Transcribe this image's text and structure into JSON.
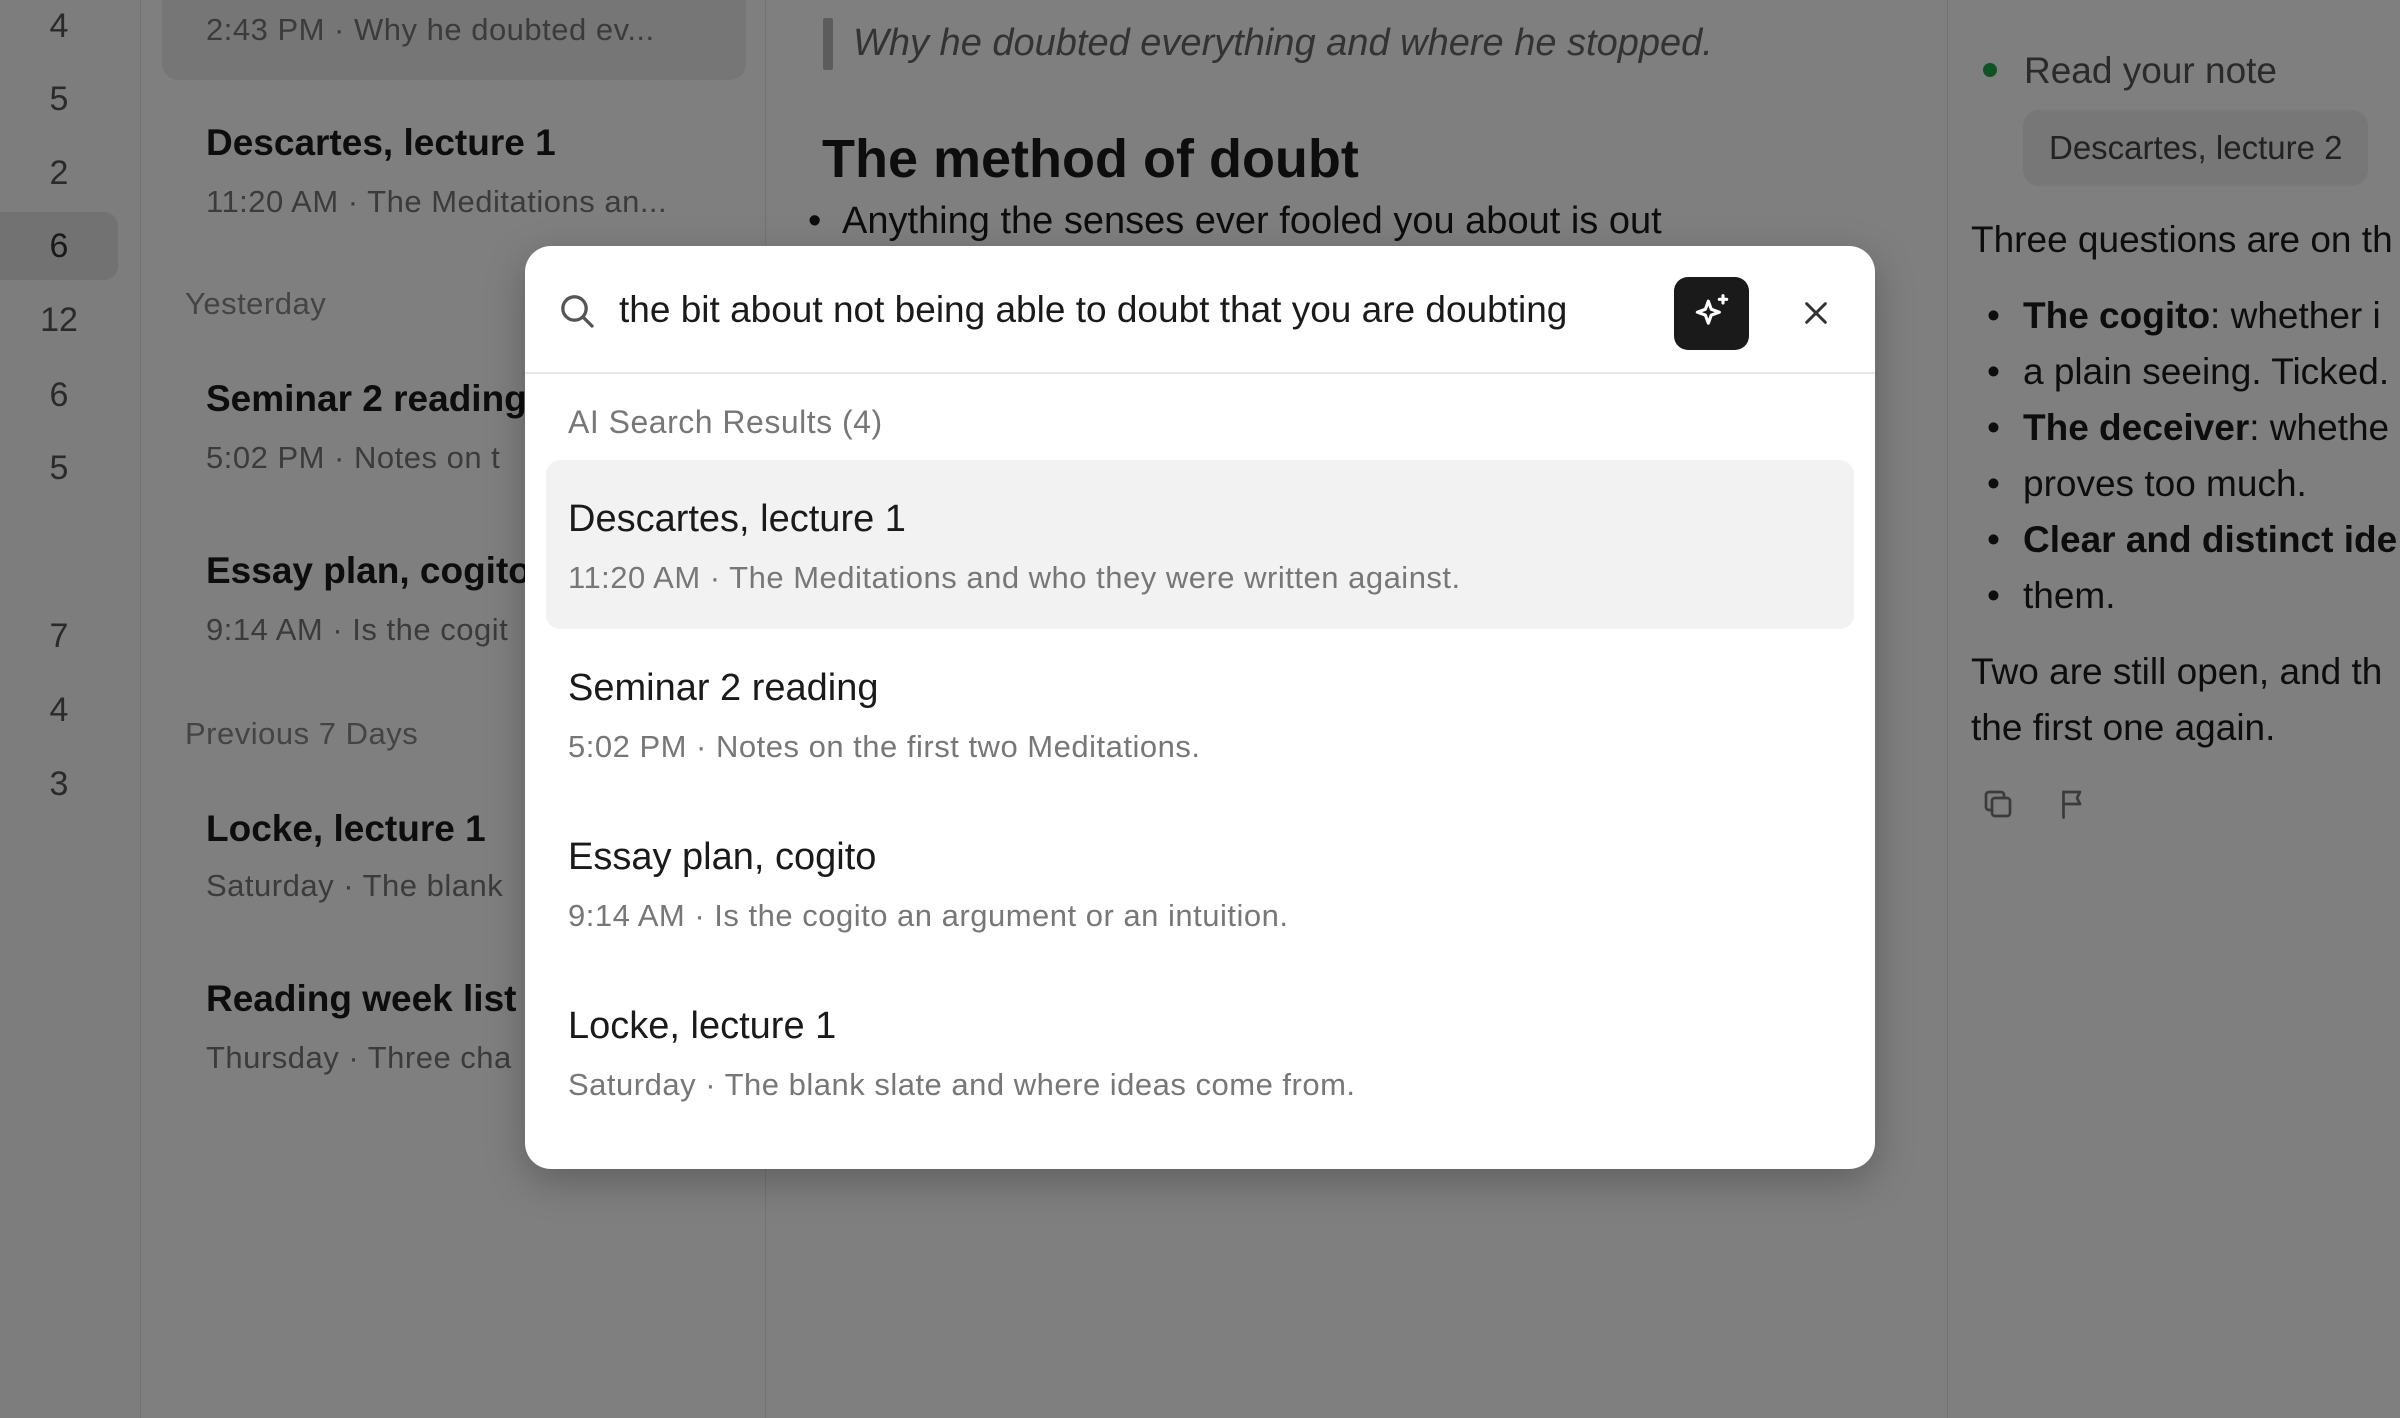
{
  "rail": {
    "counts": [
      "4",
      "5",
      "2",
      "6",
      "12",
      "6",
      "5",
      "7",
      "4",
      "3"
    ]
  },
  "notelist": {
    "selected_meta": "2:43 PM · Why he doubted ev...",
    "items": [
      {
        "title": "Descartes, lecture 1",
        "meta": "11:20 AM · The Meditations an..."
      },
      {
        "title": "Seminar 2 reading",
        "meta": "5:02 PM · Notes on t"
      },
      {
        "title": "Essay plan, cogito",
        "meta": "9:14 AM · Is the cogit"
      },
      {
        "title": "Locke, lecture 1",
        "meta": "Saturday · The blank"
      },
      {
        "title": "Reading week list",
        "meta": "Thursday · Three cha"
      }
    ],
    "groups": {
      "yesterday": "Yesterday",
      "previous7": "Previous 7 Days"
    }
  },
  "editor": {
    "quote": "Why he doubted everything and where he stopped.",
    "heading": "The method of doubt",
    "bullet1": "Anything the senses ever fooled you about is out"
  },
  "assistant": {
    "status": "Read your note",
    "note_chip": "Descartes, lecture 2",
    "intro": "Three questions are on th",
    "bullets": [
      {
        "bold": "The cogito",
        "rest": ": whether i",
        "cont": "a plain seeing. Ticked."
      },
      {
        "bold": "The deceiver",
        "rest": ": whethe",
        "cont": "proves too much."
      },
      {
        "bold": "Clear and distinct ide",
        "rest": "",
        "cont": "them."
      }
    ],
    "outro_line1": "Two are still open, and th",
    "outro_line2": "the first one again."
  },
  "search": {
    "query": "the bit about not being able to doubt that you are doubting",
    "results_heading": "AI Search Results (4)",
    "results": [
      {
        "title": "Descartes, lecture 1",
        "meta": "11:20 AM · The Meditations and who they were written against."
      },
      {
        "title": "Seminar 2 reading",
        "meta": "5:02 PM · Notes on the first two Meditations."
      },
      {
        "title": "Essay plan, cogito",
        "meta": "9:14 AM · Is the cogito an argument or an intuition."
      },
      {
        "title": "Locke, lecture 1",
        "meta": "Saturday · The blank slate and where ideas come from."
      }
    ]
  },
  "icons": {
    "search": "search-icon",
    "ai": "sparkles-icon",
    "close": "close-icon",
    "copy": "copy-icon",
    "flag": "flag-icon"
  },
  "colors": {
    "status_green": "#1fa64a",
    "ai_button": "#1a1a1a",
    "highlight": "#f2f2f2"
  }
}
